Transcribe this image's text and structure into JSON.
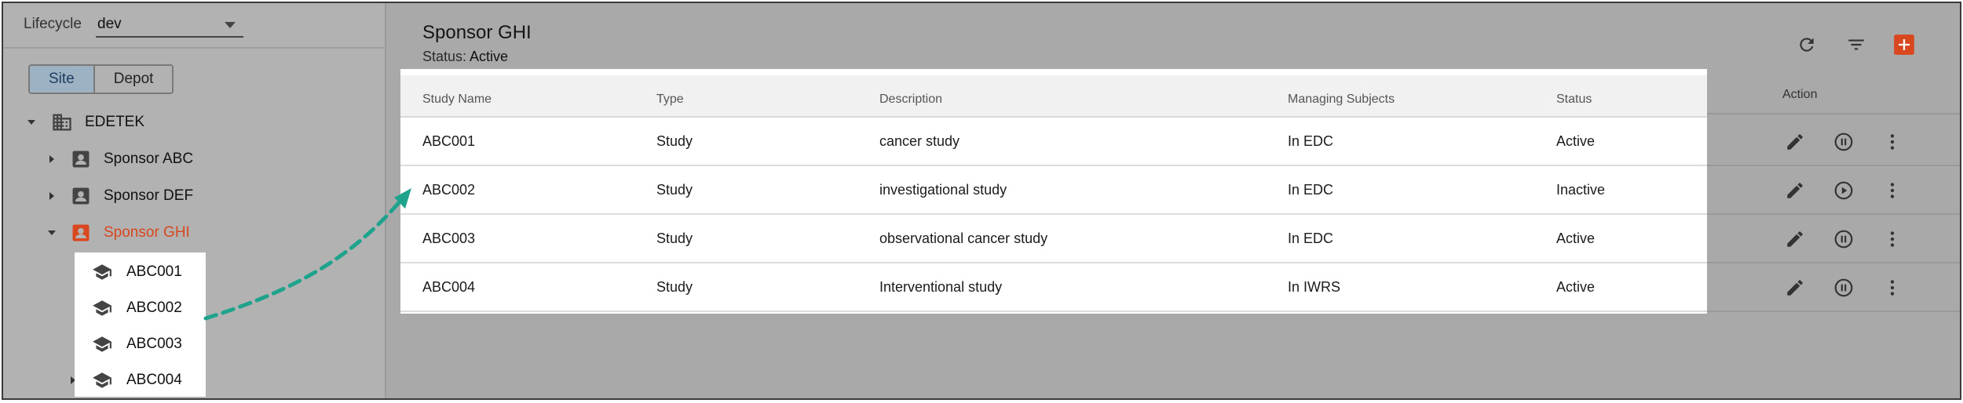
{
  "sidebar": {
    "lifecycle_label": "Lifecycle",
    "lifecycle_value": "dev",
    "toggle": {
      "site": "Site",
      "depot": "Depot",
      "active": "Site"
    },
    "tree": {
      "root": "EDETEK",
      "sponsors": [
        "Sponsor ABC",
        "Sponsor DEF",
        "Sponsor GHI"
      ],
      "selected_sponsor": "Sponsor GHI",
      "studies": [
        "ABC001",
        "ABC002",
        "ABC003",
        "ABC004"
      ]
    }
  },
  "main": {
    "title": "Sponsor GHI",
    "status_label": "Status:",
    "status_value": "Active",
    "toolbar_icons": [
      "refresh-icon",
      "filter-icon",
      "add-icon"
    ],
    "columns": [
      "Study Name",
      "Type",
      "Description",
      "Managing Subjects",
      "Status",
      "Action"
    ],
    "rows": [
      {
        "study_name": "ABC001",
        "type": "Study",
        "description": "cancer study",
        "managing_subjects": "In EDC",
        "status": "Active",
        "toggle_icon": "pause-icon"
      },
      {
        "study_name": "ABC002",
        "type": "Study",
        "description": "investigational study",
        "managing_subjects": "In EDC",
        "status": "Inactive",
        "toggle_icon": "play-icon"
      },
      {
        "study_name": "ABC003",
        "type": "Study",
        "description": "observational cancer study",
        "managing_subjects": "In EDC",
        "status": "Active",
        "toggle_icon": "pause-icon"
      },
      {
        "study_name": "ABC004",
        "type": "Study",
        "description": "Interventional study",
        "managing_subjects": "In IWRS",
        "status": "Active",
        "toggle_icon": "pause-icon"
      }
    ]
  },
  "colors": {
    "accent": "#d9471e",
    "overlay_grey": "#a9a9a9",
    "arrow": "#1fa38c",
    "selected_toggle": "#9db2c3"
  }
}
